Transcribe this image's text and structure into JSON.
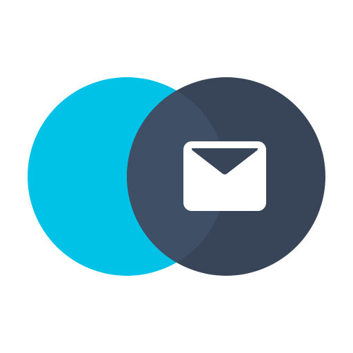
{
  "logo": {
    "icon": "envelope-icon",
    "colors": {
      "background": "#ffffff",
      "left_circle": "#00c2e6",
      "right_circle": "#384457",
      "overlap": "#3f4f66",
      "envelope_body": "#ffffff",
      "envelope_flap": "#384457"
    }
  }
}
